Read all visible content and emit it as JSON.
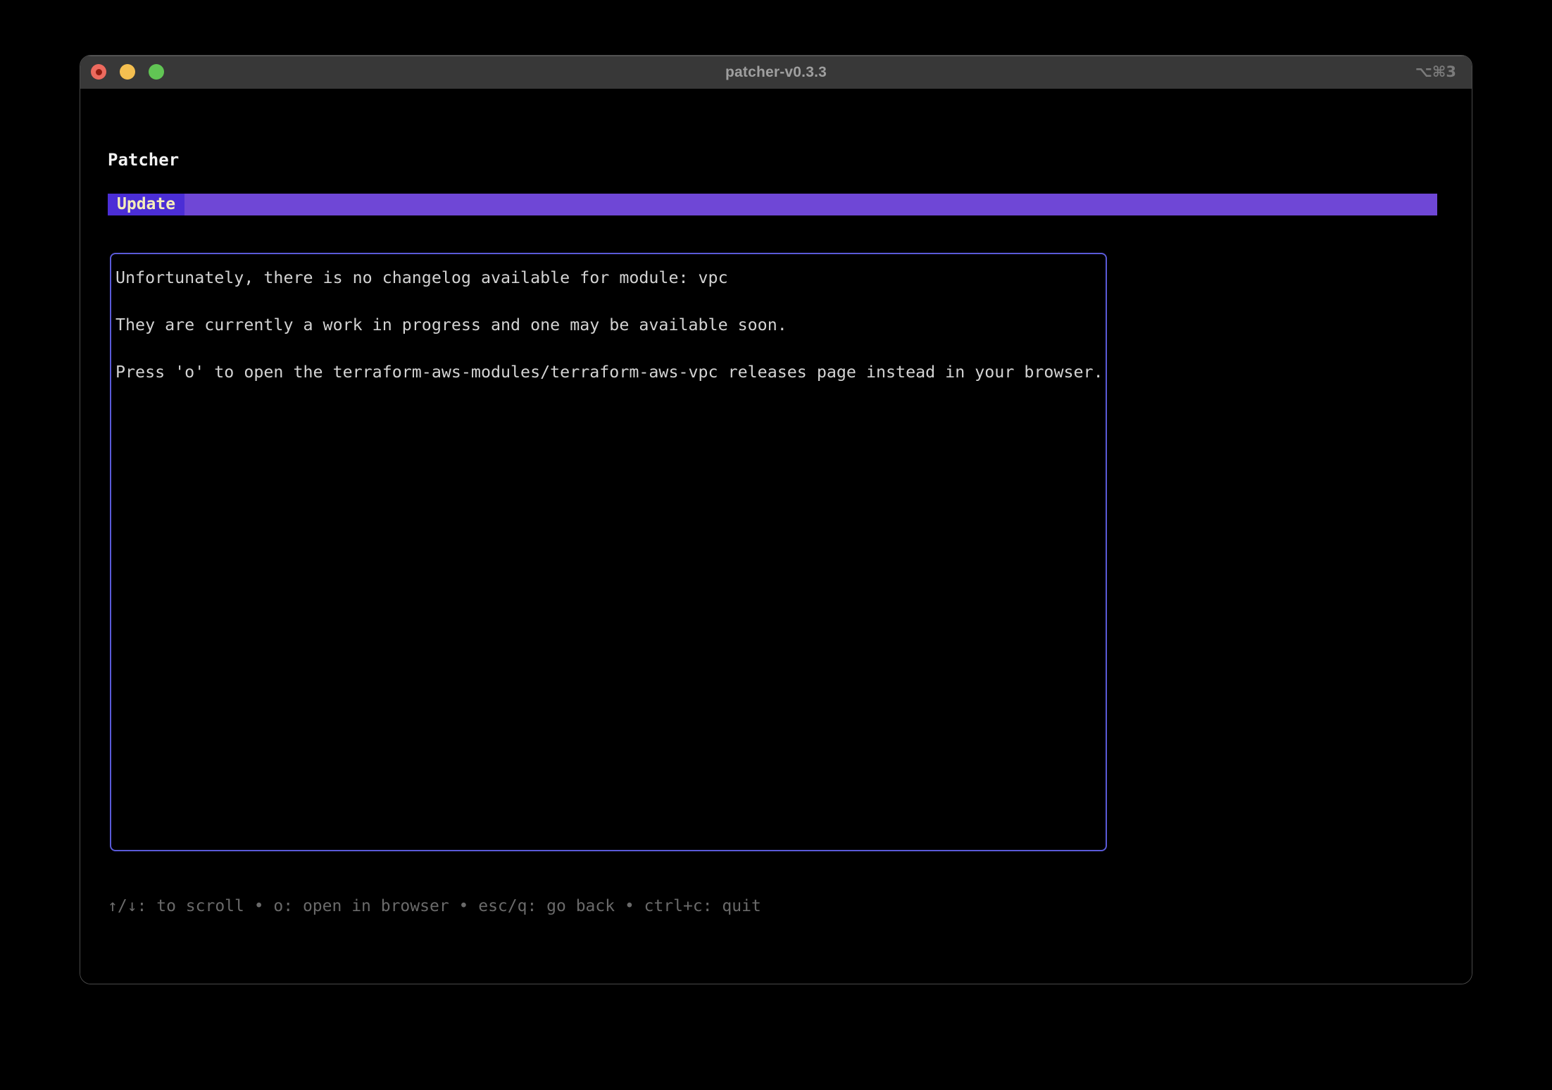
{
  "window": {
    "title": "patcher-v0.3.3",
    "shortcut_hint": "⌥⌘3"
  },
  "app": {
    "heading": "Patcher",
    "tabs": {
      "active": "Update"
    },
    "changelog": {
      "lines": [
        "Unfortunately, there is no changelog available for module: vpc",
        "They are currently a work in progress and one may be available soon.",
        "Press 'o' to open the terraform-aws-modules/terraform-aws-vpc releases page instead in your browser."
      ]
    },
    "help": {
      "separator": "•",
      "items": [
        {
          "keys": "↑/↓",
          "action": "to scroll"
        },
        {
          "keys": "o",
          "action": "open in browser"
        },
        {
          "keys": "esc/q",
          "action": "go back"
        },
        {
          "keys": "ctrl+c",
          "action": "quit"
        }
      ]
    }
  },
  "colors": {
    "canvas_bg": "#000000",
    "titlebar_bg": "#383838",
    "window_border": "#4a4a4a",
    "title_text": "#9f9f9f",
    "shortcut_text": "#7b7b7b",
    "traffic_red": "#ed6a5e",
    "traffic_red_dot": "#8f1b10",
    "traffic_yellow": "#f4bf50",
    "traffic_green": "#61c554",
    "heading_text": "#f2f2f2",
    "tab_bar_bg": "#6f47d6",
    "tab_active_bg": "#4b2ed6",
    "tab_active_text": "#f5edba",
    "box_border": "#5a5ad8",
    "body_text": "#d3d3d3",
    "help_text": "#6a6a6a"
  }
}
